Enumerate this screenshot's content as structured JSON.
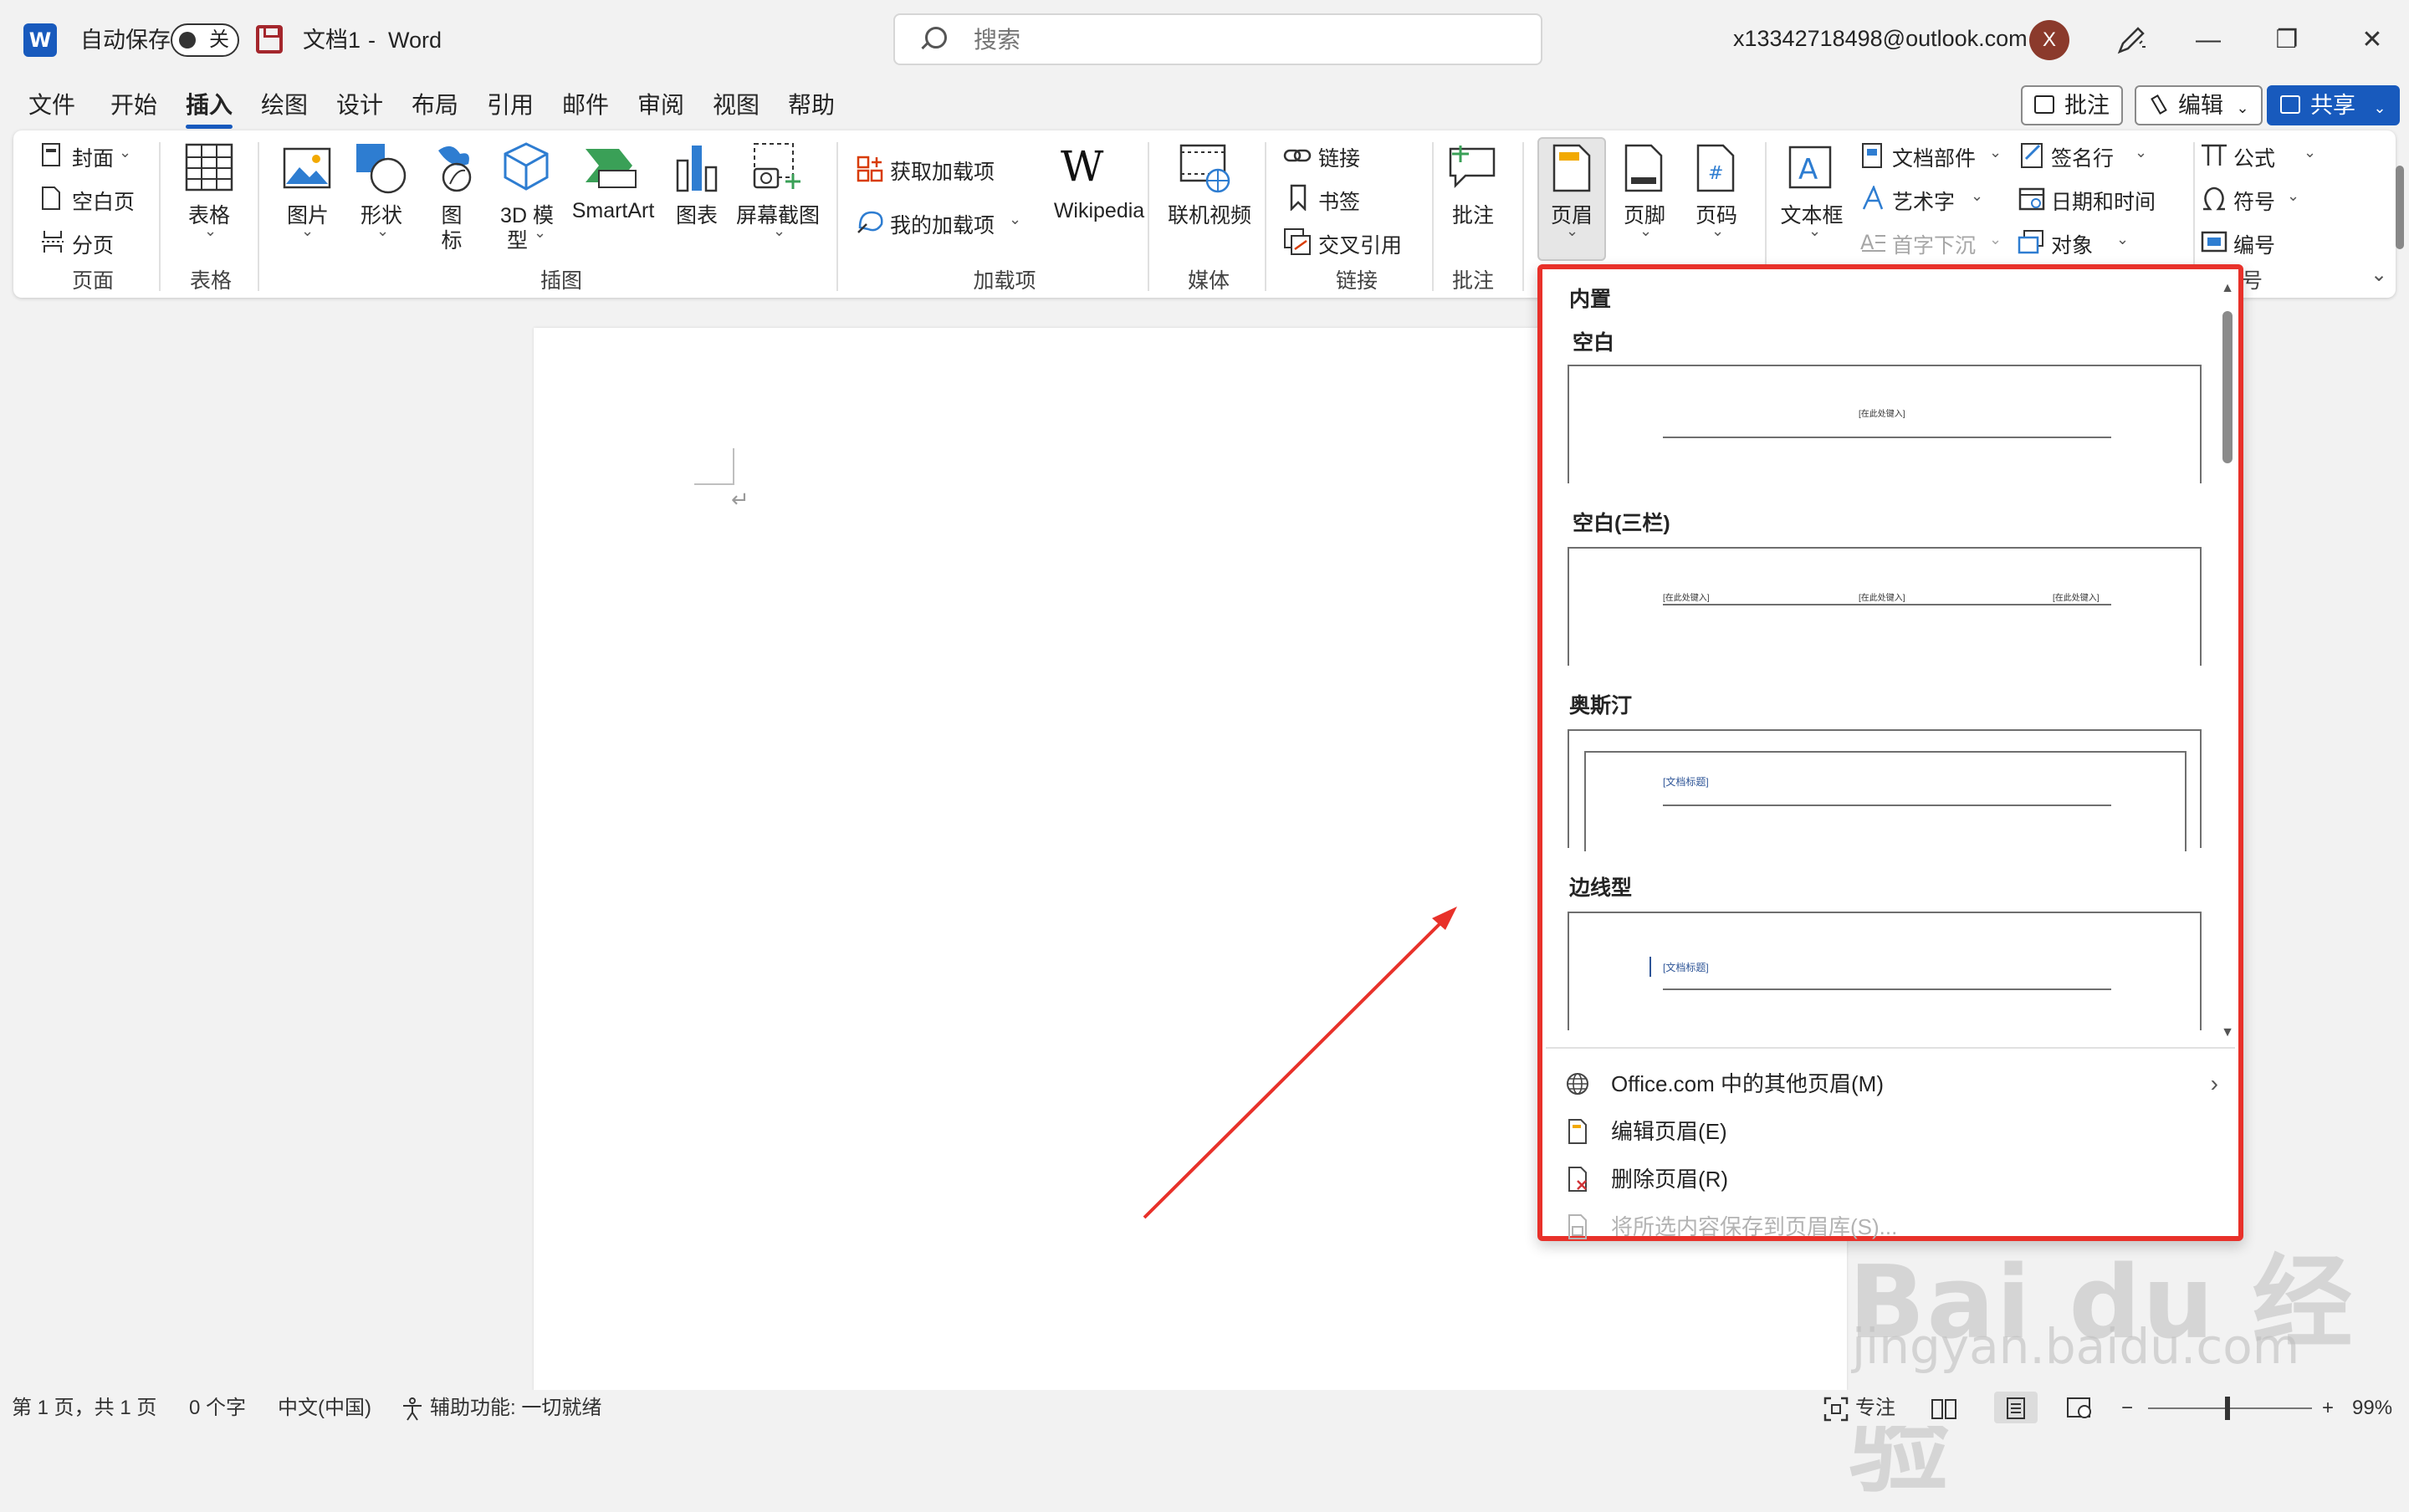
{
  "titlebar": {
    "autosave_label": "自动保存",
    "autosave_state": "关",
    "doc_name": "文档1",
    "separator": "-",
    "app_name": "Word",
    "search_placeholder": "搜索",
    "account": "x13342718498@outlook.com",
    "avatar_initial": "X",
    "minimize": "—",
    "restore": "❐",
    "close": "✕"
  },
  "menu_tabs": [
    "文件",
    "开始",
    "插入",
    "绘图",
    "设计",
    "布局",
    "引用",
    "邮件",
    "审阅",
    "视图",
    "帮助"
  ],
  "active_tab": "插入",
  "top_buttons": {
    "comment": "批注",
    "edit": "编辑",
    "share": "共享"
  },
  "ribbon": {
    "pages": {
      "cover": "封面",
      "blank": "空白页",
      "break": "分页",
      "group": "页面"
    },
    "table": {
      "table": "表格",
      "group": "表格"
    },
    "illustrations": {
      "picture": "图片",
      "shapes": "形状",
      "icons_1": "图",
      "icons_2": "标",
      "model_1": "3D 模",
      "model_2": "型",
      "smartart": "SmartArt",
      "chart": "图表",
      "screenshot": "屏幕截图",
      "group": "插图"
    },
    "addins": {
      "get": "获取加载项",
      "my": "我的加载项",
      "wikipedia": "Wikipedia",
      "wiki_logo": "W",
      "group": "加载项"
    },
    "media": {
      "video": "联机视频",
      "group": "媒体"
    },
    "links": {
      "link": "链接",
      "bookmark": "书签",
      "crossref": "交叉引用",
      "group": "链接"
    },
    "comments": {
      "comment": "批注",
      "group": "批注"
    },
    "header_footer": {
      "header": "页眉",
      "footer": "页脚",
      "page_number": "页码"
    },
    "text": {
      "textbox": "文本框",
      "quick_parts": "文档部件",
      "wordart": "艺术字",
      "dropcap": "首字下沉",
      "signature": "签名行",
      "datetime": "日期和时间",
      "object": "对象"
    },
    "symbols": {
      "equation": "公式",
      "symbol": "符号",
      "number": "编号",
      "group_partial": "号"
    }
  },
  "gallery": {
    "section": "内置",
    "items": [
      {
        "name": "空白",
        "placeholders": [
          "[在此处键入]"
        ]
      },
      {
        "name": "空白(三栏)",
        "placeholders": [
          "[在此处键入]",
          "[在此处键入]",
          "[在此处键入]"
        ]
      },
      {
        "name": "奥斯汀",
        "placeholders": [
          "[文档标题]"
        ]
      },
      {
        "name": "边线型",
        "placeholders": [
          "[文档标题]"
        ]
      }
    ],
    "menu": [
      {
        "label": "Office.com 中的其他页眉(M)",
        "icon": "globe-icon",
        "enabled": true
      },
      {
        "label": "编辑页眉(E)",
        "icon": "page-icon",
        "enabled": true
      },
      {
        "label": "删除页眉(R)",
        "icon": "delete-page-icon",
        "enabled": true
      },
      {
        "label": "将所选内容保存到页眉库(S)...",
        "icon": "save-gallery-icon",
        "enabled": false
      }
    ]
  },
  "document": {
    "paragraph_mark": "↵"
  },
  "statusbar": {
    "page": "第 1 页，共 1 页",
    "words": "0 个字",
    "language": "中文(中国)",
    "accessibility": "辅助功能: 一切就绪",
    "focus": "专注",
    "zoom_minus": "−",
    "zoom_plus": "+",
    "zoom": "99%",
    "zoom_level": 0.99
  },
  "watermark": {
    "line1": "Bai du 经验",
    "line2": "jingyan.baidu.com"
  },
  "colors": {
    "accent": "#185abd",
    "highlight_border": "#e8312a",
    "arrow": "#e8312a"
  }
}
